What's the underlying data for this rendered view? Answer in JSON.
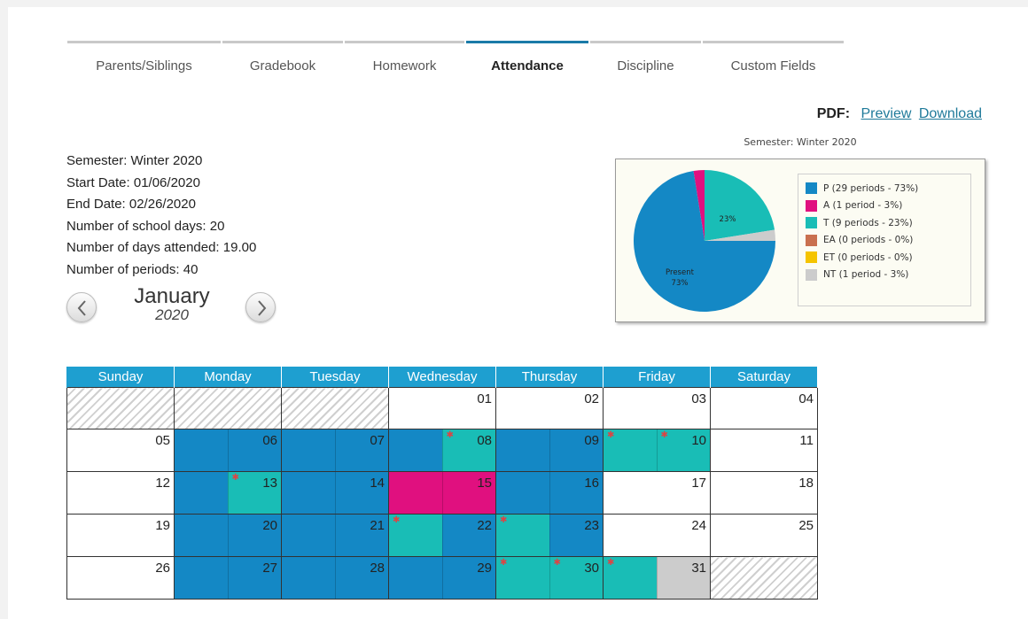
{
  "tabs": [
    {
      "label": "Parents/Siblings",
      "active": false
    },
    {
      "label": "Gradebook",
      "active": false
    },
    {
      "label": "Homework",
      "active": false
    },
    {
      "label": "Attendance",
      "active": true
    },
    {
      "label": "Discipline",
      "active": false
    },
    {
      "label": "Custom Fields",
      "active": false
    }
  ],
  "pdf": {
    "label": "PDF:",
    "preview": "Preview",
    "download": "Download"
  },
  "info": {
    "semester": "Semester: Winter 2020",
    "start_date": "Start Date: 01/06/2020",
    "end_date": "End Date: 02/26/2020",
    "school_days": "Number of school days: 20",
    "days_attended": "Number of days attended: 19.00",
    "periods": "Number of periods: 40"
  },
  "month_nav": {
    "month": "January",
    "year": "2020",
    "prev_icon": "chevron-left-icon",
    "next_icon": "chevron-right-icon"
  },
  "colors": {
    "P": "#1488c5",
    "A": "#e0107f",
    "T": "#19bdb6",
    "EA": "#c9704f",
    "ET": "#f5c400",
    "NT": "#cccccc",
    "header": "#1e9fd0"
  },
  "chart_data": {
    "type": "pie",
    "title": "Semester: Winter 2020",
    "slices": [
      {
        "code": "P",
        "label": "P (29 periods - 73%)",
        "periods": 29,
        "percent": 73,
        "slice_label": "Present",
        "slice_pct_label": "73%"
      },
      {
        "code": "A",
        "label": "A (1 period - 3%)",
        "periods": 1,
        "percent": 3
      },
      {
        "code": "T",
        "label": "T (9 periods - 23%)",
        "periods": 9,
        "percent": 23,
        "slice_pct_label": "23%"
      },
      {
        "code": "EA",
        "label": "EA (0 periods - 0%)",
        "periods": 0,
        "percent": 0
      },
      {
        "code": "ET",
        "label": "ET (0 periods - 0%)",
        "periods": 0,
        "percent": 0
      },
      {
        "code": "NT",
        "label": "NT (1 period - 3%)",
        "periods": 1,
        "percent": 3
      }
    ],
    "legend_position": "right"
  },
  "calendar": {
    "days": [
      "Sunday",
      "Monday",
      "Tuesday",
      "Wednesday",
      "Thursday",
      "Friday",
      "Saturday"
    ],
    "weeks": [
      [
        {
          "blank": true
        },
        {
          "blank": true
        },
        {
          "blank": true
        },
        {
          "day": "01"
        },
        {
          "day": "02"
        },
        {
          "day": "03"
        },
        {
          "day": "04"
        }
      ],
      [
        {
          "day": "05"
        },
        {
          "day": "06",
          "am": "P",
          "pm": "P"
        },
        {
          "day": "07",
          "am": "P",
          "pm": "P"
        },
        {
          "day": "08",
          "am": "P",
          "pm": "T",
          "pm_star": true
        },
        {
          "day": "09",
          "am": "P",
          "pm": "P"
        },
        {
          "day": "10",
          "am": "T",
          "pm": "T",
          "am_star": true,
          "pm_star": true
        },
        {
          "day": "11"
        }
      ],
      [
        {
          "day": "12"
        },
        {
          "day": "13",
          "am": "P",
          "pm": "T",
          "pm_star": true
        },
        {
          "day": "14",
          "am": "P",
          "pm": "P"
        },
        {
          "day": "15",
          "am": "A",
          "pm": "A"
        },
        {
          "day": "16",
          "am": "P",
          "pm": "P"
        },
        {
          "day": "17"
        },
        {
          "day": "18"
        }
      ],
      [
        {
          "day": "19"
        },
        {
          "day": "20",
          "am": "P",
          "pm": "P"
        },
        {
          "day": "21",
          "am": "P",
          "pm": "P"
        },
        {
          "day": "22",
          "am": "T",
          "pm": "P",
          "am_star": true
        },
        {
          "day": "23",
          "am": "T",
          "pm": "P",
          "am_star": true
        },
        {
          "day": "24"
        },
        {
          "day": "25"
        }
      ],
      [
        {
          "day": "26"
        },
        {
          "day": "27",
          "am": "P",
          "pm": "P"
        },
        {
          "day": "28",
          "am": "P",
          "pm": "P"
        },
        {
          "day": "29",
          "am": "P",
          "pm": "P"
        },
        {
          "day": "30",
          "am": "T",
          "pm": "T",
          "am_star": true,
          "pm_star": true
        },
        {
          "day": "31",
          "am": "T",
          "pm": "NT",
          "am_star": true
        },
        {
          "blank": true
        }
      ]
    ]
  }
}
